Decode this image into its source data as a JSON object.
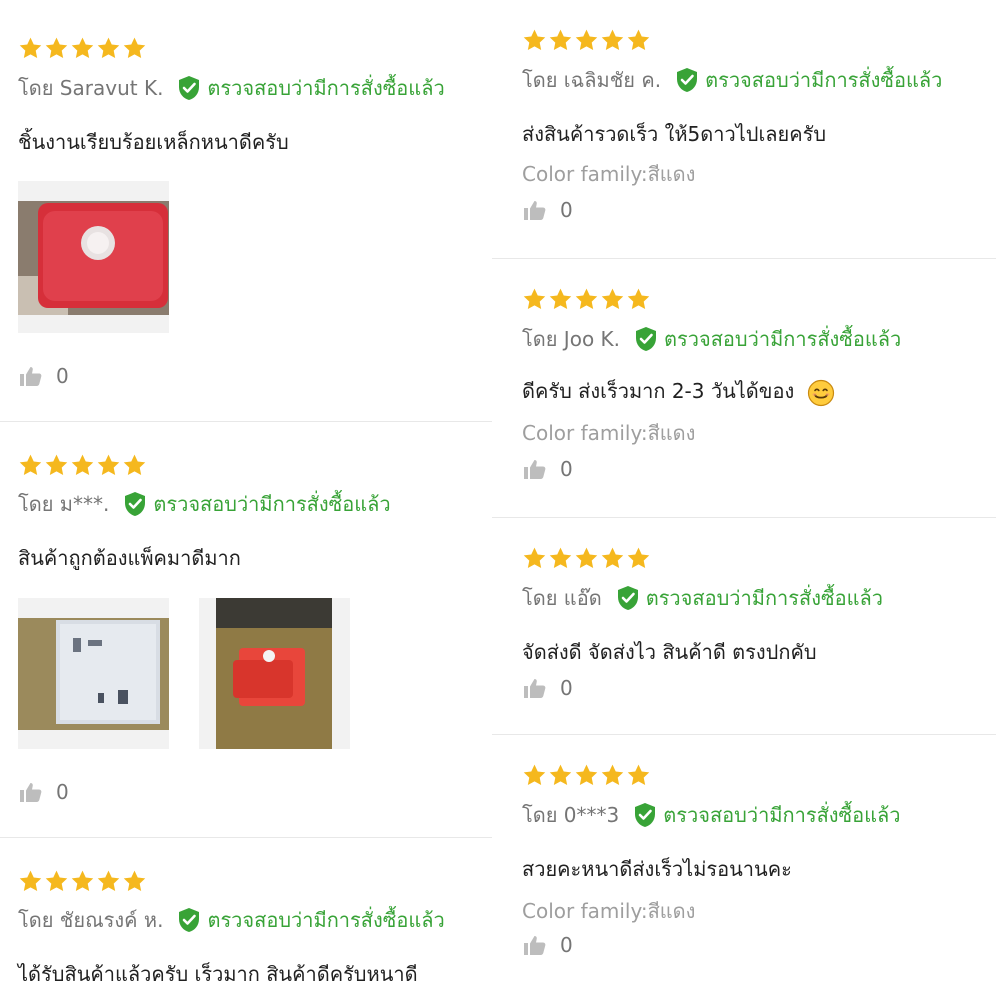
{
  "colors": {
    "star": "#f5b81e",
    "verified": "#38a337",
    "author": "#757575",
    "variant": "#9e9e9e"
  },
  "icons": {
    "star": "star-icon",
    "verified": "verified-shield-icon",
    "like": "thumbs-up-icon",
    "emoji": "smiling-face-icon"
  },
  "reviews": [
    {
      "rating": 5,
      "author": "โดย Saravut K.",
      "verified": "ตรวจสอบว่ามีการสั่งซื้อแล้ว",
      "text": "ชิ้นงานเรียบร้อยเหล็กหนาดีครับ",
      "likes": "0"
    },
    {
      "rating": 5,
      "author": "โดย ม***.",
      "verified": "ตรวจสอบว่ามีการสั่งซื้อแล้ว",
      "text": "สินค้าถูกต้องแพ็คมาดีมาก",
      "likes": "0"
    },
    {
      "rating": 5,
      "author": "โดย ชัยณรงค์ ห.",
      "verified": "ตรวจสอบว่ามีการสั่งซื้อแล้ว",
      "text": "ได้รับสินค้าแล้วครับ เร็วมาก สินค้าดีครับหนาดี"
    },
    {
      "rating": 5,
      "author": "โดย เฉลิมชัย ค.",
      "verified": "ตรวจสอบว่ามีการสั่งซื้อแล้ว",
      "text": "ส่งสินค้ารวดเร็ว   ให้5ดาวไปเลยครับ",
      "variant": "Color family:สีแดง",
      "likes": "0"
    },
    {
      "rating": 5,
      "author": "โดย Joo K.",
      "verified": "ตรวจสอบว่ามีการสั่งซื้อแล้ว",
      "text": "ดีครับ ส่งเร็วมาก 2-3 วันได้ของ",
      "variant": "Color family:สีแดง",
      "likes": "0"
    },
    {
      "rating": 5,
      "author": "โดย แอ๊ด",
      "verified": "ตรวจสอบว่ามีการสั่งซื้อแล้ว",
      "text": "จัดส่งดี จัดส่งไว  สินค้าดี ตรงปกคับ",
      "likes": "0"
    },
    {
      "rating": 5,
      "author": "โดย 0***3",
      "verified": "ตรวจสอบว่ามีการสั่งซื้อแล้ว",
      "text": "สวยคะหนาดีส่งเร็วไม่รอนานคะ",
      "variant": "Color family:สีแดง",
      "likes": "0"
    }
  ]
}
